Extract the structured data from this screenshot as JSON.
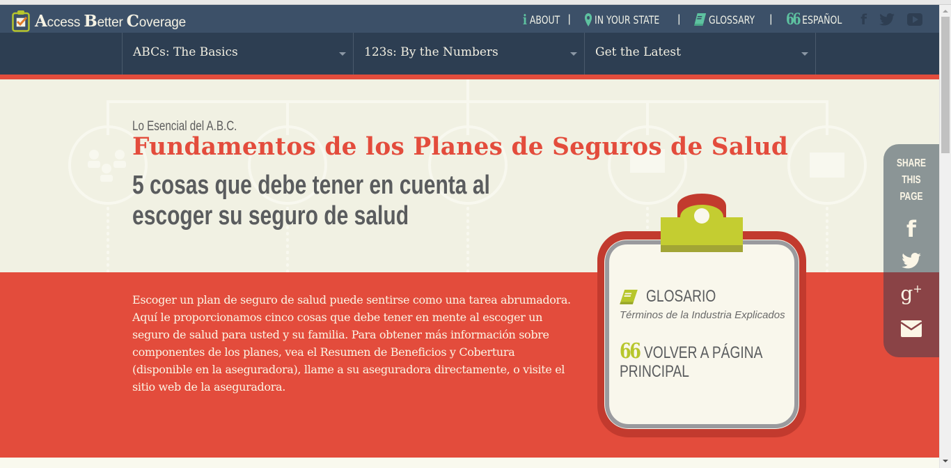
{
  "header": {
    "logo": {
      "first": "A",
      "w1": "ccess ",
      "second": "B",
      "w2": "etter ",
      "third": "C",
      "w3": "overage",
      "full": "Access Better Coverage"
    },
    "links": [
      {
        "icon": "info-icon",
        "glyph": "i",
        "label": "ABOUT"
      },
      {
        "icon": "map-pin-icon",
        "glyph": "⚲",
        "label": "IN YOUR STATE"
      },
      {
        "icon": "book-icon",
        "glyph": "▰",
        "label": "GLOSSARY"
      },
      {
        "icon": "quote-icon",
        "glyph": "❝",
        "label": "ESPAÑOL"
      }
    ],
    "separator": "|",
    "social": [
      {
        "icon": "facebook-icon",
        "glyph": "f"
      },
      {
        "icon": "twitter-icon",
        "glyph": "🐦"
      },
      {
        "icon": "youtube-icon",
        "glyph": "▶"
      }
    ]
  },
  "nav": {
    "items": [
      {
        "label": "ABCs: The Basics"
      },
      {
        "label": "123s: By the Numbers"
      },
      {
        "label": "Get the Latest"
      }
    ]
  },
  "hero": {
    "kicker": "Lo Esencial del A.B.C.",
    "title": "Fundamentos de los Planes de Seguros de Salud",
    "subtitle": "5 cosas que debe tener en cuenta al escoger su seguro de salud"
  },
  "intro": {
    "text": "Escoger un plan de seguro de salud puede sentirse como una tarea abrumadora. Aquí le proporcionamos cinco cosas que debe tener en mente al escoger un seguro de salud para usted y su familia. Para obtener más información sobre componentes de los planes, vea el Resumen de Beneficios y Cobertura (disponible en la aseguradora), llame a su aseguradora directamente, o visite el sitio web de la aseguradora."
  },
  "clipboard": {
    "glossary_title": "GLOSARIO",
    "glossary_sub": "Términos de la Industria Explicados",
    "back_quote": "66",
    "back_label": "VOLVER A PÁGINA PRINCIPAL"
  },
  "share": {
    "label_lines": [
      "SHARE",
      "THIS",
      "PAGE"
    ],
    "buttons": [
      {
        "icon": "facebook-icon",
        "glyph": "f"
      },
      {
        "icon": "twitter-icon",
        "glyph": "twitter"
      },
      {
        "icon": "google-plus-icon",
        "glyph": "g+"
      },
      {
        "icon": "email-icon",
        "glyph": "✉"
      }
    ]
  },
  "colors": {
    "header_bg": "#3c5068",
    "nav_bg": "#2d3e52",
    "accent_red": "#e34c3c",
    "accent_teal": "#5ec2a0",
    "accent_green": "#b7c62c",
    "cream": "#f1f1e3"
  }
}
